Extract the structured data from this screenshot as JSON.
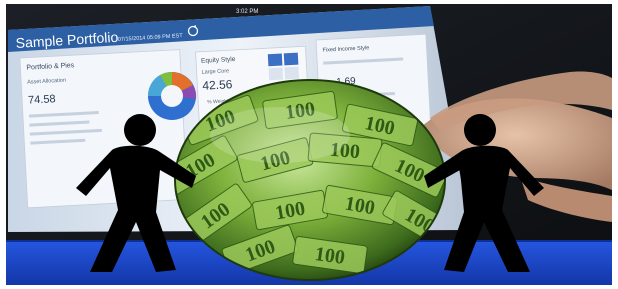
{
  "tablet": {
    "status_time": "3:02 PM",
    "app_title": "Sample Portfolio",
    "timestamp": "07/15/2014 05:09 PM EST",
    "left_panel": {
      "header": "Portfolio & Pies",
      "section_label": "Asset Allocation",
      "value": "74.58"
    },
    "middle_panel": {
      "header": "Equity Style",
      "sub_label": "Large Core",
      "value": "42.56",
      "note": "% Weight"
    },
    "right_panel": {
      "header": "Fixed Income Style",
      "value": "1.69"
    }
  },
  "banknote_label": "100",
  "colors": {
    "background_dark": "#15181c",
    "screen_light": "#e7eef6",
    "screen_header": "#2c5fa3",
    "table_blue": "#1f4fd1",
    "table_edge": "#0d2f9a",
    "banknote_green": "#7fb23c",
    "banknote_dark": "#2e5a16",
    "silhouette": "#000000",
    "frame": "#ffffff"
  },
  "icons": [
    "pie-chart-icon",
    "refresh-icon",
    "person-silhouette-icon"
  ]
}
